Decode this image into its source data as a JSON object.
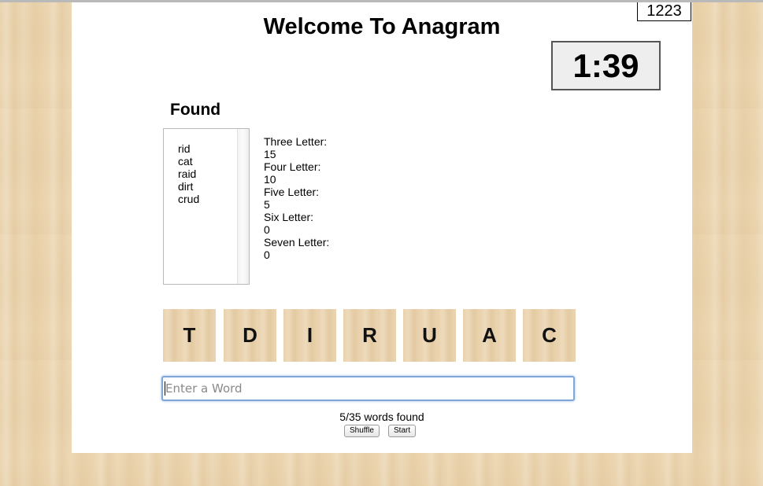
{
  "score": "1223",
  "title": "Welcome To Anagram",
  "timer": "1:39",
  "found": {
    "heading": "Found",
    "words": [
      "rid",
      "cat",
      "raid",
      "dirt",
      "crud"
    ]
  },
  "stats": [
    {
      "label": "Three Letter:",
      "value": "15"
    },
    {
      "label": "Four Letter:",
      "value": "10"
    },
    {
      "label": "Five Letter:",
      "value": "5"
    },
    {
      "label": "Six Letter:",
      "value": "0"
    },
    {
      "label": "Seven Letter:",
      "value": "0"
    }
  ],
  "tiles": [
    "T",
    "D",
    "I",
    "R",
    "U",
    "A",
    "C"
  ],
  "input": {
    "placeholder": "Enter a Word",
    "value": ""
  },
  "progress": "5/35 words found",
  "buttons": {
    "shuffle": "Shuffle",
    "start": "Start"
  },
  "colors": {
    "background": "#ecd6b1",
    "panel": "#ffffff",
    "tile": "#e9d2ac",
    "input_focus": "#7ea6d8",
    "timer_bg": "#eeeeee"
  }
}
